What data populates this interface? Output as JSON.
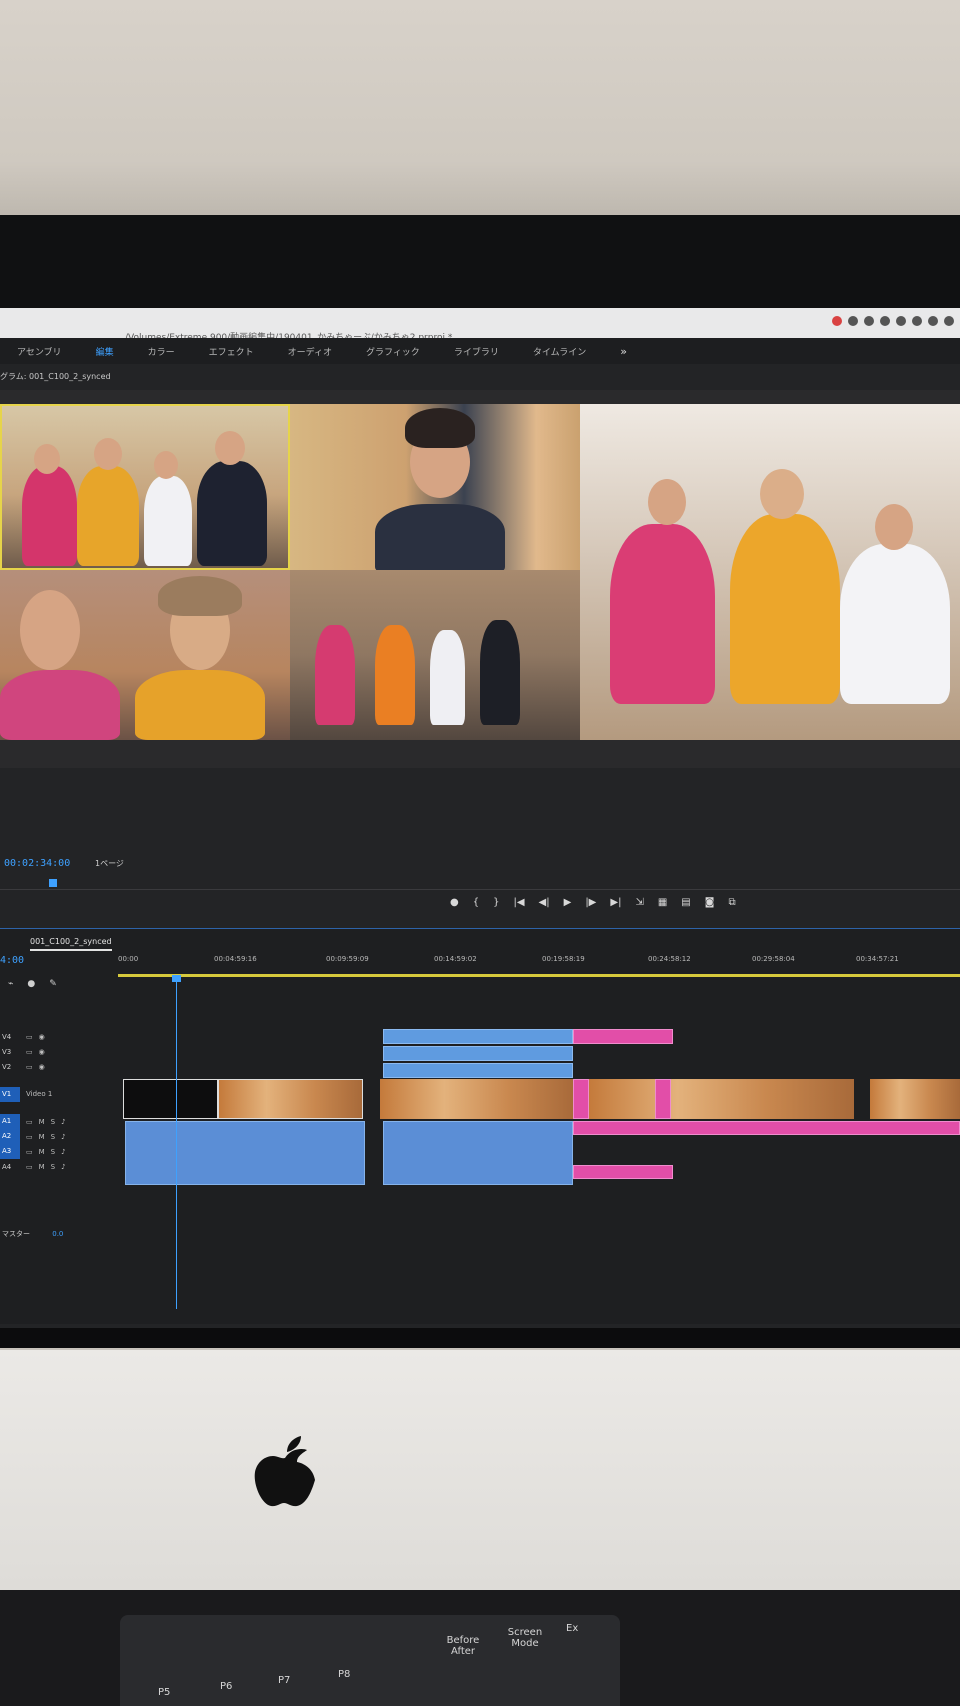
{
  "window": {
    "path": "/Volumes/Extreme 900/動画編集中/190401_かみちゃーぶ/かみちゃ2.prproj *"
  },
  "workspaces": [
    {
      "label": "アセンブリ",
      "active": false
    },
    {
      "label": "編集",
      "active": true
    },
    {
      "label": "カラー",
      "active": false
    },
    {
      "label": "エフェクト",
      "active": false
    },
    {
      "label": "オーディオ",
      "active": false
    },
    {
      "label": "グラフィック",
      "active": false
    },
    {
      "label": "ライブラリ",
      "active": false
    },
    {
      "label": "タイムライン",
      "active": false
    }
  ],
  "workspaces_more": "»",
  "program": {
    "title": "グラム: 001_C100_2_synced",
    "timecode": "00:02:34:00",
    "page_select": "1ページ"
  },
  "timeline": {
    "sequence_tab": "001_C100_2_synced",
    "timecode": "4:00",
    "ruler": [
      "00:00",
      "00:04:59:16",
      "00:09:59:09",
      "00:14:59:02",
      "00:19:58:19",
      "00:24:58:12",
      "00:29:58:04",
      "00:34:57:21"
    ],
    "video_tracks": [
      "V4",
      "V3",
      "V2",
      "V1"
    ],
    "v1_name": "Video 1",
    "audio_tracks": [
      "A1",
      "A2",
      "A3",
      "A4"
    ],
    "audio_m": "M",
    "audio_s": "S",
    "master_label": "マスター",
    "master_value": "0.0"
  },
  "keypad": {
    "keys": [
      "P5",
      "P6",
      "P7",
      "P8"
    ],
    "before_after": "Before After",
    "screen_mode": "Screen Mode",
    "exp": "Ex"
  },
  "colors": {
    "accent": "#3ea1ff",
    "clip_blue": "#5f9be0",
    "clip_pink": "#e24ea8",
    "workarea": "#d6c93c"
  }
}
